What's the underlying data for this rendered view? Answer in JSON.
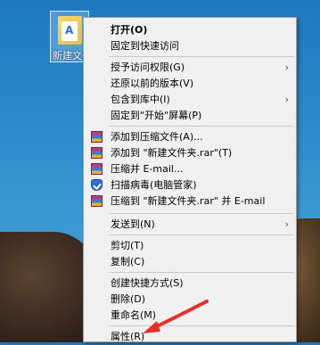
{
  "desktop": {
    "icon_label": "新建文件"
  },
  "menu": {
    "items": [
      {
        "label": "打开(O)",
        "bold": true
      },
      {
        "label": "固定到快速访问"
      },
      {
        "label": "授予访问权限(G)",
        "submenu": true
      },
      {
        "label": "还原以前的版本(V)"
      },
      {
        "label": "包含到库中(I)",
        "submenu": true
      },
      {
        "label": "固定到\"开始\"屏幕(P)"
      },
      {
        "label": "添加到压缩文件(A)...",
        "icon": "winrar-icon"
      },
      {
        "label": "添加到 \"新建文件夹.rar\"(T)",
        "icon": "winrar-icon"
      },
      {
        "label": "压缩并 E-mail...",
        "icon": "winrar-icon"
      },
      {
        "label": "扫描病毒(电脑管家)",
        "icon": "shield-icon"
      },
      {
        "label": "压缩到 \"新建文件夹.rar\" 并 E-mail",
        "icon": "winrar-icon"
      },
      {
        "label": "发送到(N)",
        "submenu": true
      },
      {
        "label": "剪切(T)"
      },
      {
        "label": "复制(C)"
      },
      {
        "label": "创建快捷方式(S)"
      },
      {
        "label": "删除(D)"
      },
      {
        "label": "重命名(M)"
      },
      {
        "label": "属性(R)"
      }
    ]
  },
  "colors": {
    "annotation_arrow": "#e8302a",
    "menu_background": "#f0f0f0"
  }
}
